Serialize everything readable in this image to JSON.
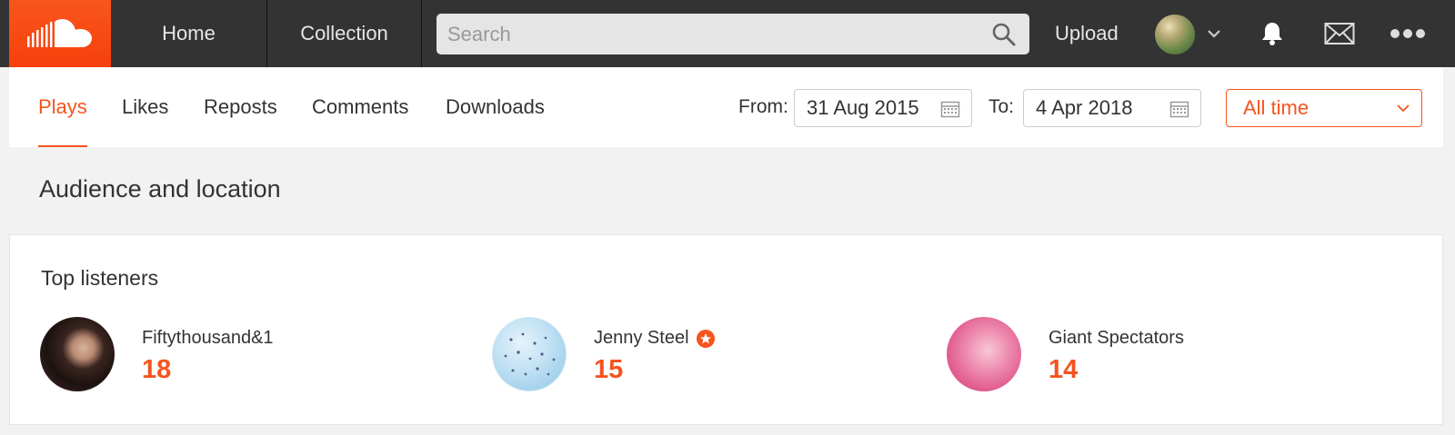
{
  "header": {
    "nav": {
      "home": "Home",
      "collection": "Collection"
    },
    "search_placeholder": "Search",
    "upload_label": "Upload",
    "icons": [
      "soundcloud-logo",
      "search-icon",
      "avatar",
      "chevron-down-icon",
      "bell-icon",
      "mail-icon",
      "more-icon"
    ]
  },
  "tabs": [
    {
      "label": "Plays",
      "active": true
    },
    {
      "label": "Likes",
      "active": false
    },
    {
      "label": "Reposts",
      "active": false
    },
    {
      "label": "Comments",
      "active": false
    },
    {
      "label": "Downloads",
      "active": false
    }
  ],
  "filters": {
    "from_label": "From:",
    "from_value": "31 Aug 2015",
    "to_label": "To:",
    "to_value": "4 Apr 2018",
    "range_value": "All time"
  },
  "section": {
    "title": "Audience and location",
    "card_title": "Top listeners",
    "listeners": [
      {
        "name": "Fiftythousand&1",
        "count": "18"
      },
      {
        "name": "Jenny Steel",
        "count": "15",
        "pro": true
      },
      {
        "name": "Giant Spectators",
        "count": "14"
      }
    ]
  },
  "colors": {
    "accent": "#f5541e",
    "topbar": "#333333",
    "background": "#f2f2f2"
  }
}
